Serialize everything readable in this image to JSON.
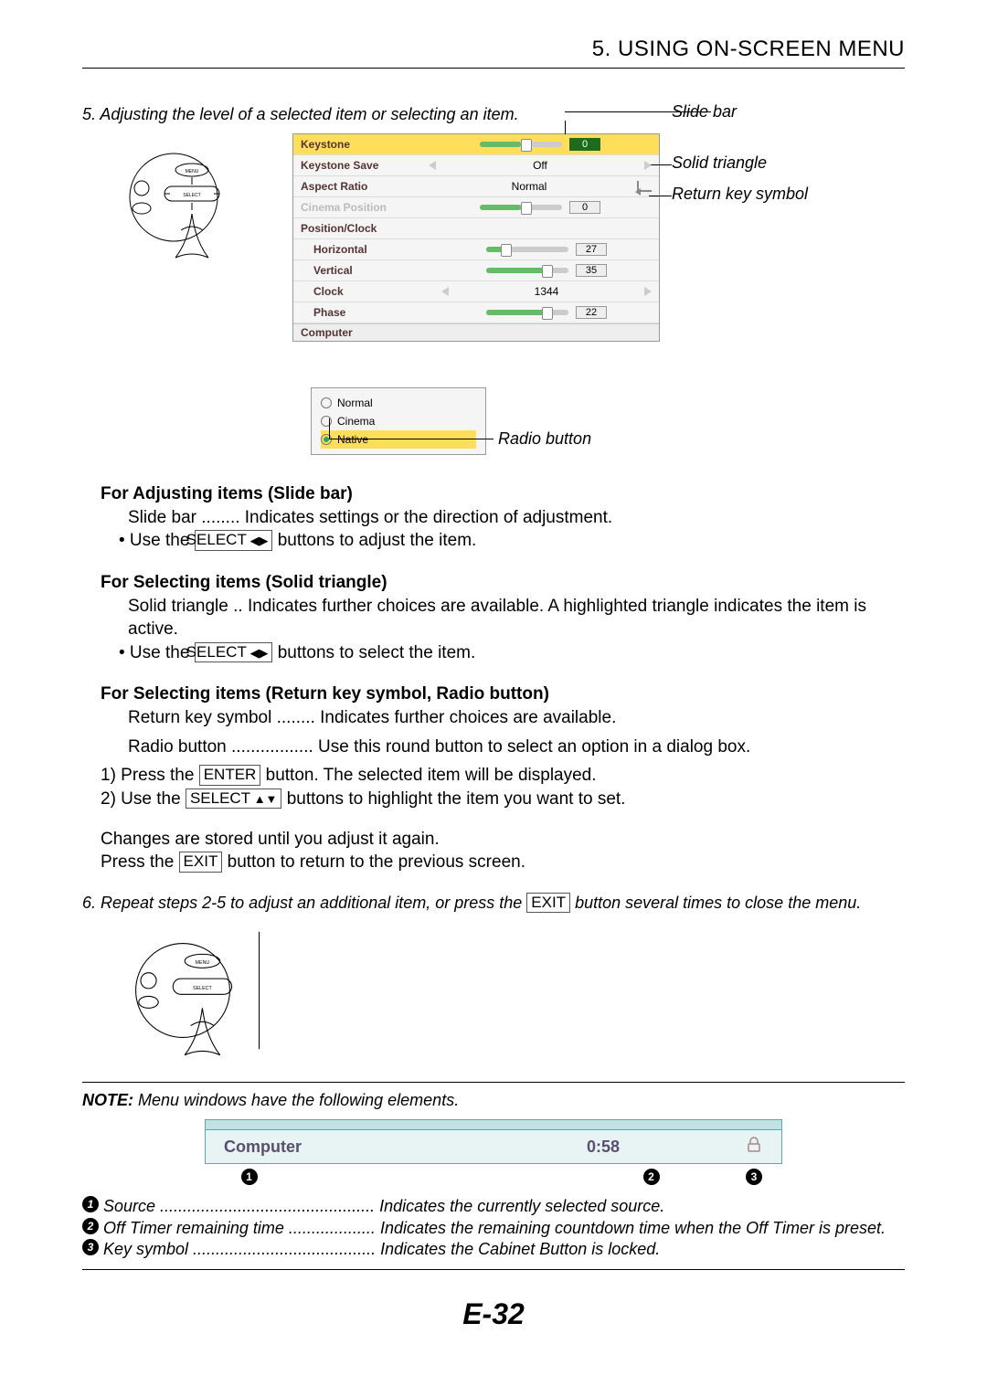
{
  "chapter": "5. USING ON-SCREEN MENU",
  "step5": "5. Adjusting the level of a selected item or selecting an item.",
  "annot": {
    "slidebar": "Slide bar",
    "solidtriangle": "Solid triangle",
    "returnkey": "Return key symbol",
    "radiobutton": "Radio button"
  },
  "menu": {
    "keystone": "Keystone",
    "keystone_save": "Keystone Save",
    "aspect": "Aspect Ratio",
    "cinema": "Cinema Position",
    "posclock": "Position/Clock",
    "horiz": "Horizontal",
    "vert": "Vertical",
    "clock": "Clock",
    "phase": "Phase",
    "footer": "Computer",
    "val_keystone": "0",
    "val_off": "Off",
    "val_normal": "Normal",
    "val_cinema": "0",
    "val_horiz": "27",
    "val_vert": "35",
    "val_clock": "1344",
    "val_phase": "22"
  },
  "radio": {
    "normal": "Normal",
    "cinema": "Cinema",
    "native": "Native"
  },
  "sec1": {
    "h": "For Adjusting items (Slide bar)",
    "l1a": "Slide bar ........ Indicates settings or the direction of adjustment.",
    "l2a": "• Use the ",
    "l2b": " buttons to adjust the item."
  },
  "sec2": {
    "h": "For Selecting items (Solid triangle)",
    "l1a": "Solid triangle .. Indicates further choices are available. A highlighted triangle indicates the item is active.",
    "l2a": "• Use the ",
    "l2b": " buttons to select the item."
  },
  "sec3": {
    "h": "For Selecting items (Return key symbol, Radio button)",
    "l1": "Return key symbol ........ Indicates further choices are available.",
    "l2": "Radio button ................. Use this round button to select an option in a dialog box.",
    "l3a": "1) Press the ",
    "l3b": " button. The selected item will be displayed.",
    "l4a": "2) Use the ",
    "l4b": " buttons to highlight the item you want to set.",
    "l5": "Changes are stored until you adjust it again.",
    "l6a": "Press the ",
    "l6b": " button to return to the previous screen."
  },
  "step6a": "6. Repeat steps 2-5 to adjust an additional item, or press the ",
  "step6b": " button several times to close the menu.",
  "keys": {
    "select_lr": "SELECT",
    "select_ud": "SELECT",
    "enter": "ENTER",
    "exit": "EXIT"
  },
  "note_h": "NOTE:",
  "note_t": " Menu windows have the following elements.",
  "infobar": {
    "source": "Computer",
    "time": "0:58"
  },
  "legend": {
    "l1k": "Source ...............................................",
    "l1v": "Indicates the currently selected source.",
    "l2k": "Off Timer remaining time ...................",
    "l2v": "Indicates the remaining countdown time when the Off Timer is preset.",
    "l3k": "Key symbol ........................................",
    "l3v": "Indicates the Cabinet Button is locked."
  },
  "markers": {
    "m1": "1",
    "m2": "2",
    "m3": "3"
  },
  "pagenum": "E-32"
}
